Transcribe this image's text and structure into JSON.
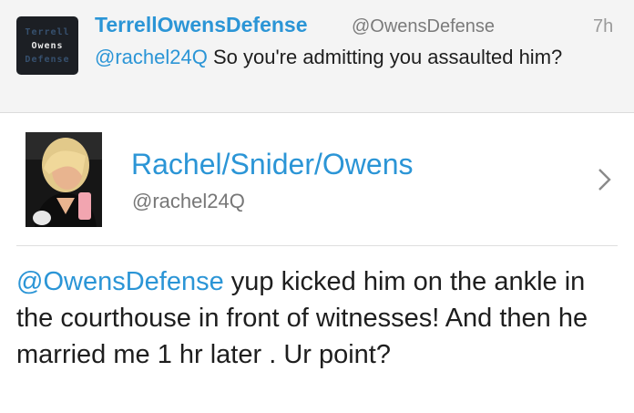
{
  "reply_tweet": {
    "logo": {
      "line1": "Terrell",
      "line2": "Owens",
      "line3": "Defense"
    },
    "display_name": "TerrellOwensDefense",
    "handle": "@OwensDefense",
    "time": "7h",
    "mention": "@rachel24Q",
    "text": " So you're admitting you assaulted him?"
  },
  "main_tweet": {
    "display_name": "Rachel/Snider/Owens",
    "handle": "@rachel24Q",
    "mention": "@OwensDefense",
    "text": " yup kicked him on the ankle in the courthouse in front of witnesses! And then he married me 1 hr later . Ur point?"
  }
}
